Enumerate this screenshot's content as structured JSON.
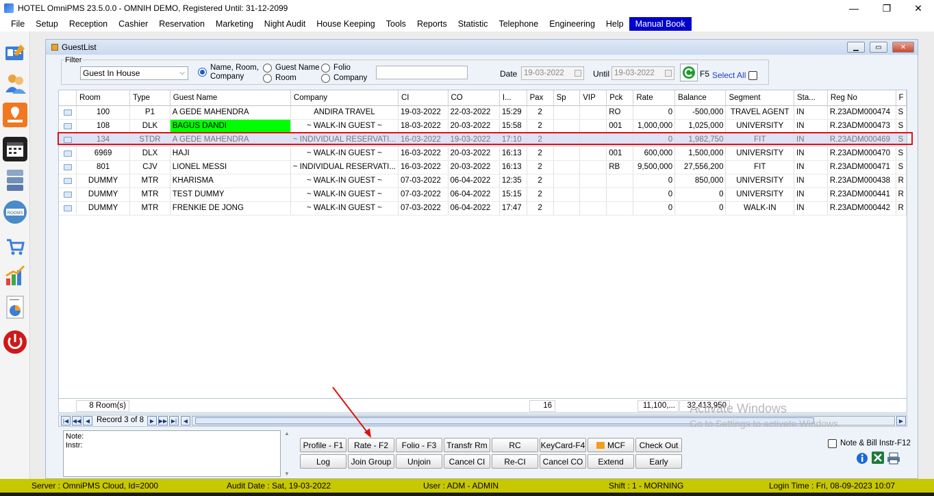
{
  "window": {
    "title": "HOTEL OmniPMS 23.5.0.0 - OMNIH DEMO, Registered Until: 31-12-2099",
    "minimize": "—",
    "maximize": "❐",
    "close": "✕"
  },
  "menu": [
    "File",
    "Setup",
    "Reception",
    "Cashier",
    "Reservation",
    "Marketing",
    "Night Audit",
    "House Keeping",
    "Tools",
    "Reports",
    "Statistic",
    "Telephone",
    "Engineering",
    "Help",
    "Manual Book"
  ],
  "colors": {
    "accent": "#0000cc",
    "status_bar": "#c8c800",
    "selected_row": "#dde2f6",
    "highlight_border": "#e01010",
    "green_cell": "#00ff00"
  },
  "sidebar_icons": [
    "guest-card-icon",
    "users-icon",
    "map-icon",
    "calendar-icon",
    "server-icon",
    "rooms-available-icon",
    "shopping-cart-icon",
    "chart-icon",
    "report-pie-icon",
    "power-icon"
  ],
  "sidebar_rooms_text": "ROOMS",
  "guestlist": {
    "title": "GuestList",
    "filter": {
      "legend": "Filter",
      "selected": "Guest In House",
      "options": {
        "name_room_company_1": "Name, Room,",
        "name_room_company_2": "Company",
        "guest_name": "Guest Name",
        "room": "Room",
        "folio": "Folio",
        "company": "Company"
      },
      "search_value": "",
      "date_label": "Date",
      "date_value": "19-03-2022",
      "until_label": "Until",
      "until_value": "19-03-2022",
      "f5_label": "F5",
      "select_all": "Select All"
    },
    "columns": [
      "",
      "Room",
      "Type",
      "Guest Name",
      "Company",
      "CI",
      "CO",
      "I...",
      "Pax",
      "Sp",
      "VIP",
      "Pck",
      "Rate",
      "Balance",
      "Segment",
      "Sta...",
      "Reg No",
      "F"
    ],
    "rows": [
      {
        "room": "100",
        "type": "P1",
        "guest": "A GEDE MAHENDRA",
        "company": "ANDIRA TRAVEL",
        "ci": "19-03-2022",
        "co": "22-03-2022",
        "time": "15:29",
        "pax": "2",
        "sp": "",
        "vip": "",
        "pck": "RO",
        "rate": "0",
        "balance": "-500,000",
        "segment": "TRAVEL AGENT",
        "status": "IN",
        "regno": "R.23ADM000474",
        "f": "S"
      },
      {
        "room": "108",
        "type": "DLK",
        "guest": "BAGUS DANDI",
        "company": "~ WALK-IN GUEST ~",
        "ci": "18-03-2022",
        "co": "20-03-2022",
        "time": "15:58",
        "pax": "2",
        "sp": "",
        "vip": "",
        "pck": "001",
        "rate": "1,000,000",
        "balance": "1,025,000",
        "segment": "UNIVERSITY",
        "status": "IN",
        "regno": "R.23ADM000473",
        "f": "S"
      },
      {
        "room": "134",
        "type": "STDR",
        "guest": "A GEDE MAHENDRA",
        "company": "~ INDIVIDUAL RESERVATI...",
        "ci": "16-03-2022",
        "co": "19-03-2022",
        "time": "17:10",
        "pax": "2",
        "sp": "",
        "vip": "",
        "pck": "",
        "rate": "0",
        "balance": "1,982,750",
        "segment": "FIT",
        "status": "IN",
        "regno": "R.23ADM000469",
        "f": "S"
      },
      {
        "room": "6969",
        "type": "DLX",
        "guest": "HAJI",
        "company": "~ WALK-IN GUEST ~",
        "ci": "16-03-2022",
        "co": "20-03-2022",
        "time": "16:13",
        "pax": "2",
        "sp": "",
        "vip": "",
        "pck": "001",
        "rate": "600,000",
        "balance": "1,500,000",
        "segment": "UNIVERSITY",
        "status": "IN",
        "regno": "R.23ADM000470",
        "f": "S"
      },
      {
        "room": "801",
        "type": "CJV",
        "guest": "LIONEL MESSI",
        "company": "~ INDIVIDUAL RESERVATI...",
        "ci": "16-03-2022",
        "co": "20-03-2022",
        "time": "16:13",
        "pax": "2",
        "sp": "",
        "vip": "",
        "pck": "RB",
        "rate": "9,500,000",
        "balance": "27,556,200",
        "segment": "FIT",
        "status": "IN",
        "regno": "R.23ADM000471",
        "f": "S"
      },
      {
        "room": "DUMMY",
        "type": "MTR",
        "guest": "KHARISMA",
        "company": "~ WALK-IN GUEST ~",
        "ci": "07-03-2022",
        "co": "06-04-2022",
        "time": "12:35",
        "pax": "2",
        "sp": "",
        "vip": "",
        "pck": "",
        "rate": "0",
        "balance": "850,000",
        "segment": "UNIVERSITY",
        "status": "IN",
        "regno": "R.23ADM000438",
        "f": "R"
      },
      {
        "room": "DUMMY",
        "type": "MTR",
        "guest": "TEST DUMMY",
        "company": "~ WALK-IN GUEST ~",
        "ci": "07-03-2022",
        "co": "06-04-2022",
        "time": "15:15",
        "pax": "2",
        "sp": "",
        "vip": "",
        "pck": "",
        "rate": "0",
        "balance": "0",
        "segment": "UNIVERSITY",
        "status": "IN",
        "regno": "R.23ADM000441",
        "f": "R"
      },
      {
        "room": "DUMMY",
        "type": "MTR",
        "guest": "FRENKIE DE JONG",
        "company": "~ WALK-IN GUEST ~",
        "ci": "07-03-2022",
        "co": "06-04-2022",
        "time": "17:47",
        "pax": "2",
        "sp": "",
        "vip": "",
        "pck": "",
        "rate": "0",
        "balance": "0",
        "segment": "WALK-IN",
        "status": "IN",
        "regno": "R.23ADM000442",
        "f": "R"
      }
    ],
    "summary": {
      "rooms": "8 Room(s)",
      "pax": "16",
      "rate": "11,100,...",
      "balance": "32,413,950"
    },
    "navigator": {
      "record": "Record 3 of 8"
    },
    "note_label": "Note:",
    "instr_label": "Instr:",
    "note_bill_label": "Note & Bill Instr-F12",
    "buttons_row1": [
      "Profile - F1",
      "Rate - F2",
      "Folio - F3",
      "Transfr Rm",
      "RC",
      "KeyCard-F4",
      "MCF",
      "Check Out"
    ],
    "buttons_row2": [
      "Log",
      "Join Group",
      "Unjoin",
      "Cancel CI",
      "Re-CI",
      "Cancel CO",
      "Extend",
      "Early"
    ]
  },
  "watermark": {
    "line1": "Activate Windows",
    "line2": "Go to Settings to activate Windows."
  },
  "status": {
    "server": "Server : OmniPMS Cloud, Id=2000",
    "audit_date": "Audit Date : Sat, 19-03-2022",
    "user": "User : ADM - ADMIN",
    "shift": "Shift : 1 - MORNING",
    "login_time": "Login Time : Fri, 08-09-2023 10:07"
  }
}
